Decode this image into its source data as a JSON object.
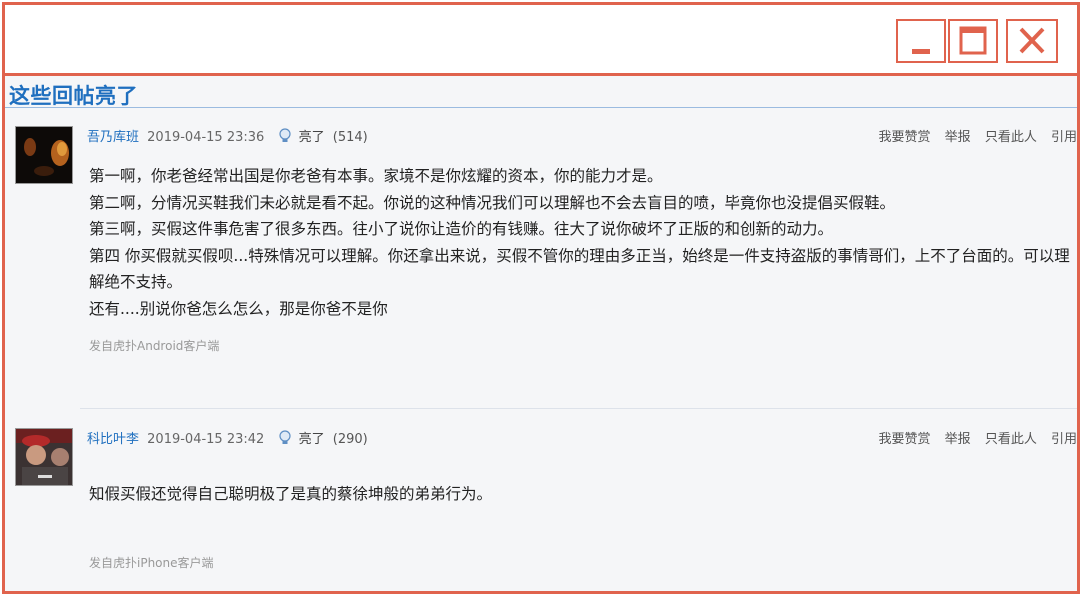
{
  "window": {
    "minimize_icon": "minimize-icon",
    "maximize_icon": "maximize-icon",
    "close_icon": "close-icon",
    "accent_color": "#e0634d"
  },
  "section": {
    "title": "这些回帖亮了"
  },
  "posts": [
    {
      "author": "吾乃库班",
      "time": "2019-04-15 23:36",
      "light_label": "亮了",
      "light_count": "(514)",
      "actions": [
        "我要赞赏",
        "举报",
        "只看此人",
        "引用"
      ],
      "paragraphs": [
        "第一啊，你老爸经常出国是你老爸有本事。家境不是你炫耀的资本，你的能力才是。",
        "第二啊，分情况买鞋我们未必就是看不起。你说的这种情况我们可以理解也不会去盲目的喷，毕竟你也没提倡买假鞋。",
        "第三啊，买假这件事危害了很多东西。往小了说你让造价的有钱赚。往大了说你破坏了正版的和创新的动力。",
        "第四 你买假就买假呗...特殊情况可以理解。你还拿出来说，买假不管你的理由多正当，始终是一件支持盗版的事情哥们，上不了台面的。可以理解绝不支持。",
        "还有....别说你爸怎么怎么，那是你爸不是你"
      ],
      "source": "发自虎扑Android客户端"
    },
    {
      "author": "科比叶李",
      "time": "2019-04-15 23:42",
      "light_label": "亮了",
      "light_count": "(290)",
      "actions": [
        "我要赞赏",
        "举报",
        "只看此人",
        "引用"
      ],
      "paragraphs": [
        "知假买假还觉得自己聪明极了是真的蔡徐坤般的弟弟行为。"
      ],
      "source": "发自虎扑iPhone客户端"
    }
  ]
}
